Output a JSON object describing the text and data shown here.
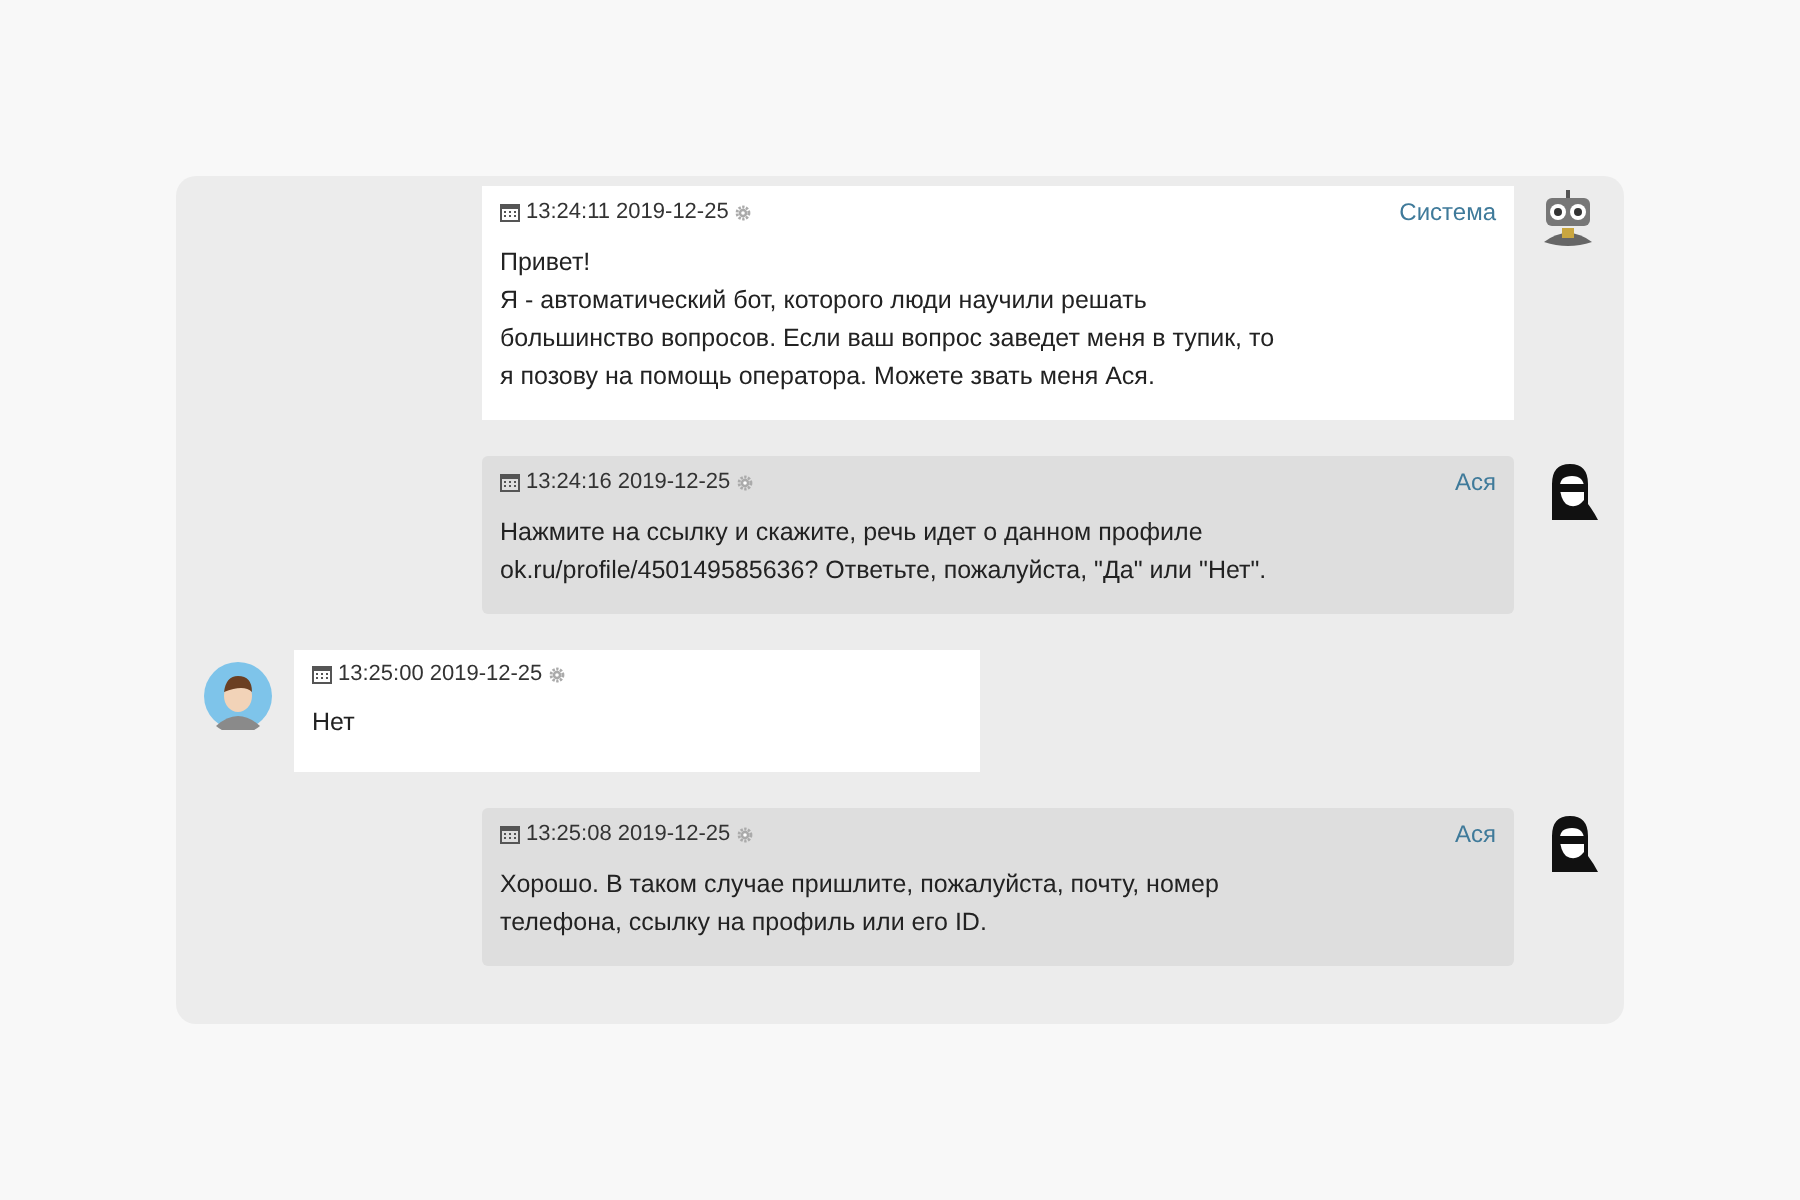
{
  "messages": [
    {
      "kind": "bot",
      "time": "13:24:11 2019-12-25",
      "author": "Система",
      "text": "Привет!\nЯ - автоматический бот, которого люди научили решать\nбольшинство вопросов. Если ваш вопрос заведет меня в тупик, то\nя позову на помощь оператора. Можете звать меня Ася."
    },
    {
      "kind": "agent",
      "time": "13:24:16 2019-12-25",
      "author": "Ася",
      "text": "Нажмите на ссылку и скажите, речь идет о данном профиле\nok.ru/profile/450149585636? Ответьте, пожалуйста, \"Да\" или \"Нет\"."
    },
    {
      "kind": "user",
      "time": "13:25:00 2019-12-25",
      "text": "Нет"
    },
    {
      "kind": "agent",
      "time": "13:25:08 2019-12-25",
      "author": "Ася",
      "text": "Хорошо. В таком случае пришлите, пожалуйста, почту, номер\nтелефона, ссылку на профиль или его ID."
    }
  ]
}
